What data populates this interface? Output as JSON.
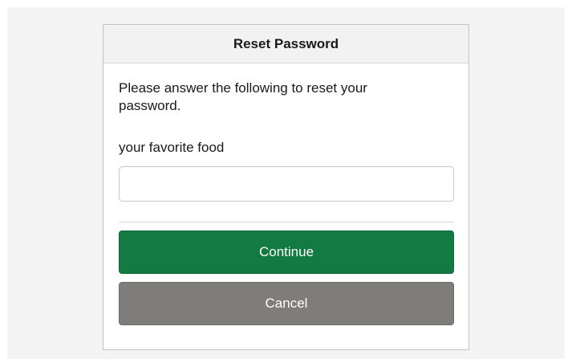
{
  "dialog": {
    "title": "Reset Password",
    "instructions": "Please answer the following to reset your password.",
    "question_label": "your favorite food",
    "answer_value": "",
    "answer_placeholder": "",
    "continue_label": "Continue",
    "cancel_label": "Cancel"
  },
  "colors": {
    "continue_bg": "#137b41",
    "cancel_bg": "#7e7d79",
    "header_bg": "#f2f2f2"
  }
}
